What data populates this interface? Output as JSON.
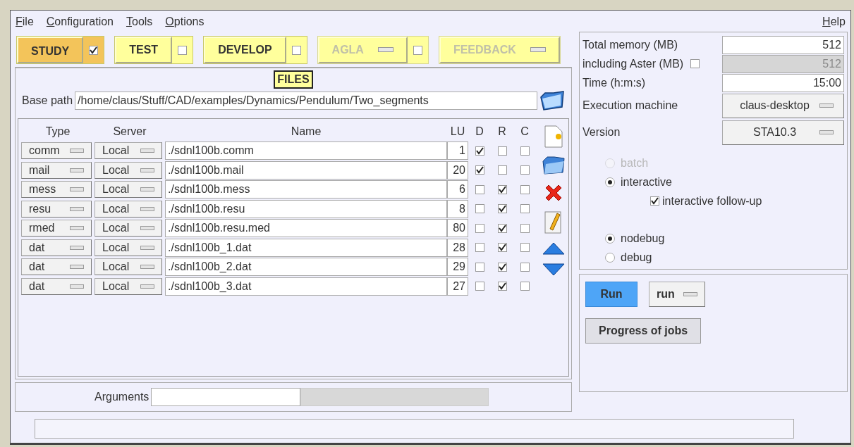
{
  "menu": [
    "File",
    "Configuration",
    "Tools",
    "Options"
  ],
  "help_menu": "Help",
  "modes": [
    {
      "label": "STUDY",
      "kind": "toggle",
      "selected": true,
      "checked": true,
      "disabled": false
    },
    {
      "label": "TEST",
      "kind": "toggle",
      "selected": false,
      "checked": false,
      "disabled": false
    },
    {
      "label": "DEVELOP",
      "kind": "toggle",
      "selected": false,
      "checked": false,
      "disabled": false
    },
    {
      "label": "AGLA",
      "kind": "menu-toggle",
      "selected": false,
      "checked": false,
      "disabled": true
    },
    {
      "label": "FEEDBACK",
      "kind": "menu",
      "selected": false,
      "disabled": true
    }
  ],
  "files": {
    "heading": "FILES",
    "base_path_label": "Base path",
    "base_path": "/home/claus/Stuff/CAD/examples/Dynamics/Pendulum/Two_segments",
    "columns": [
      "Type",
      "Server",
      "Name",
      "LU",
      "D",
      "R",
      "C"
    ],
    "rows": [
      {
        "type": "comm",
        "server": "Local",
        "name": "./sdnl100b.comm",
        "lu": "1",
        "d": true,
        "r": false,
        "c": false
      },
      {
        "type": "mail",
        "server": "Local",
        "name": "./sdnl100b.mail",
        "lu": "20",
        "d": true,
        "r": false,
        "c": false
      },
      {
        "type": "mess",
        "server": "Local",
        "name": "./sdnl100b.mess",
        "lu": "6",
        "d": false,
        "r": true,
        "c": false
      },
      {
        "type": "resu",
        "server": "Local",
        "name": "./sdnl100b.resu",
        "lu": "8",
        "d": false,
        "r": true,
        "c": false
      },
      {
        "type": "rmed",
        "server": "Local",
        "name": "./sdnl100b.resu.med",
        "lu": "80",
        "d": false,
        "r": true,
        "c": false
      },
      {
        "type": "dat",
        "server": "Local",
        "name": "./sdnl100b_1.dat",
        "lu": "28",
        "d": false,
        "r": true,
        "c": false
      },
      {
        "type": "dat",
        "server": "Local",
        "name": "./sdnl100b_2.dat",
        "lu": "29",
        "d": false,
        "r": true,
        "c": false
      },
      {
        "type": "dat",
        "server": "Local",
        "name": "./sdnl100b_3.dat",
        "lu": "27",
        "d": false,
        "r": true,
        "c": false
      }
    ],
    "arguments_label": "Arguments"
  },
  "settings": {
    "total_memory_label": "Total memory (MB)",
    "total_memory": "512",
    "aster_memory_label": "including Aster (MB)",
    "aster_memory_checked": false,
    "aster_memory": "512",
    "time_label": "Time (h:m:s)",
    "time": "15:00",
    "machine_label": "Execution machine",
    "machine": "claus-desktop",
    "version_label": "Version",
    "version": "STA10.3",
    "mode_options": [
      {
        "label": "batch",
        "selected": false,
        "disabled": true
      },
      {
        "label": "interactive",
        "selected": true,
        "disabled": false
      }
    ],
    "follow_up": {
      "label": "interactive follow-up",
      "checked": true
    },
    "debug_options": [
      {
        "label": "nodebug",
        "selected": true
      },
      {
        "label": "debug",
        "selected": false
      }
    ]
  },
  "run": {
    "button": "Run",
    "action": "run",
    "progress_button": "Progress of jobs"
  }
}
